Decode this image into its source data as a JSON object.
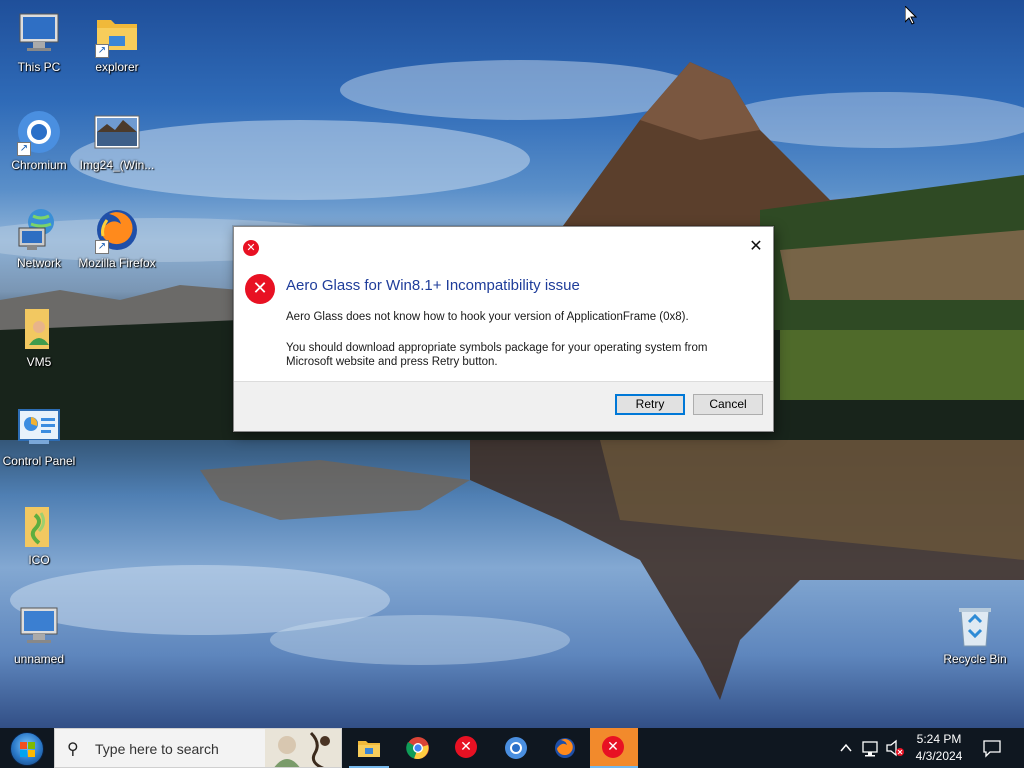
{
  "desktop": {
    "icons": [
      {
        "label": "This PC",
        "icon": "this-pc-icon"
      },
      {
        "label": "explorer",
        "icon": "folder-icon"
      },
      {
        "label": "Chromium",
        "icon": "chromium-icon"
      },
      {
        "label": "Img24_(Win...",
        "icon": "image-thumbnail-icon"
      },
      {
        "label": "Network",
        "icon": "network-icon"
      },
      {
        "label": "Mozilla Firefox",
        "icon": "firefox-icon"
      },
      {
        "label": "VM5",
        "icon": "user-folder-icon"
      },
      {
        "label": "Control Panel",
        "icon": "control-panel-icon"
      },
      {
        "label": "ICO",
        "icon": "zip-folder-icon"
      },
      {
        "label": "unnamed",
        "icon": "monitor-icon"
      },
      {
        "label": "Recycle Bin",
        "icon": "recycle-bin-icon"
      }
    ]
  },
  "dialog": {
    "title": "",
    "heading": "Aero Glass for Win8.1+ Incompatibility issue",
    "message1": "Aero Glass does not know how to hook your version of ApplicationFrame (0x8).",
    "message2": "You should download appropriate symbols package for your operating system from Microsoft website and press Retry button.",
    "buttons": {
      "retry": "Retry",
      "cancel": "Cancel"
    },
    "close_glyph": "✕",
    "error_glyph": "✕",
    "colors": {
      "heading": "#1f3d9a",
      "error": "#e81123",
      "focus": "#0078d7"
    }
  },
  "taskbar": {
    "search_placeholder": "Type here to search",
    "apps": [
      {
        "name": "file-explorer",
        "icon": "folder-icon",
        "state": "open"
      },
      {
        "name": "chrome",
        "icon": "chrome-icon",
        "state": "none"
      },
      {
        "name": "error-app-1",
        "icon": "error-x-icon",
        "state": "none"
      },
      {
        "name": "chromium",
        "icon": "chromium-icon",
        "state": "none"
      },
      {
        "name": "firefox",
        "icon": "firefox-icon",
        "state": "none"
      },
      {
        "name": "error-app-2",
        "icon": "error-x-icon",
        "state": "active"
      }
    ],
    "tray": {
      "time": "5:24 PM",
      "date": "4/3/2024",
      "icons": [
        "chevron-up-icon",
        "network-icon",
        "volume-muted-icon",
        "notification-icon"
      ]
    },
    "colors": {
      "background": "#0f1720",
      "accent": "#76b9ed",
      "active_error": "#f28a2c"
    }
  }
}
